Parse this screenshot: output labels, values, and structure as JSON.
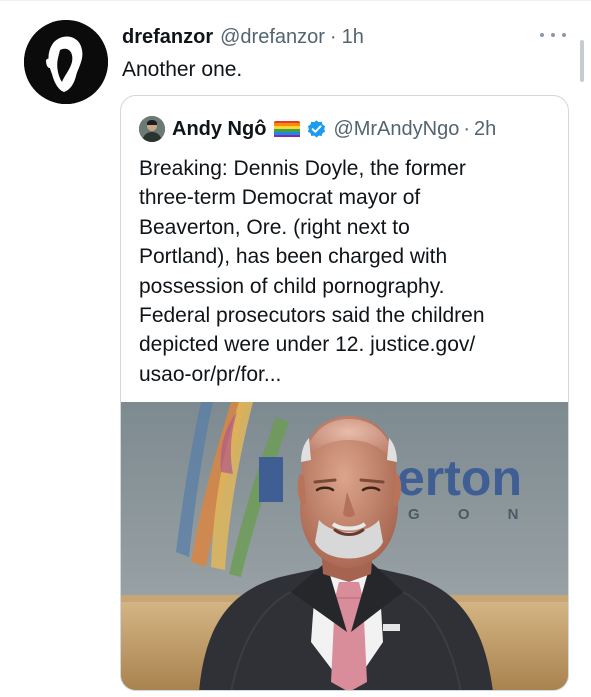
{
  "tweet": {
    "author_name": "drefanzor",
    "author_handle": "@drefanzor",
    "separator": "·",
    "time": "1h",
    "text": "Another one."
  },
  "quoted_tweet": {
    "author_name": "Andy Ngô",
    "author_handle": "@MrAndyNgo",
    "separator": "·",
    "time": "2h",
    "text_lines": [
      "Breaking: Dennis Doyle, the former",
      "three-term Democrat mayor of",
      "Beaverton, Ore. (right next to",
      "Portland), has been charged with",
      "possession of child pornography.",
      "Federal prosecutors said the children",
      "depicted were under 12. justice.gov/",
      "usao-or/pr/for..."
    ],
    "image_sign_text": "erton",
    "image_sign_subtext": "G O N"
  },
  "icons": {
    "more": "more-horizontal-icon",
    "verified": "verified-badge-icon",
    "flag": "rainbow-flag-icon"
  },
  "colors": {
    "text_primary": "#0f1419",
    "text_secondary": "#536471",
    "border": "#cfd9de",
    "verified_blue": "#1d9bf0"
  }
}
